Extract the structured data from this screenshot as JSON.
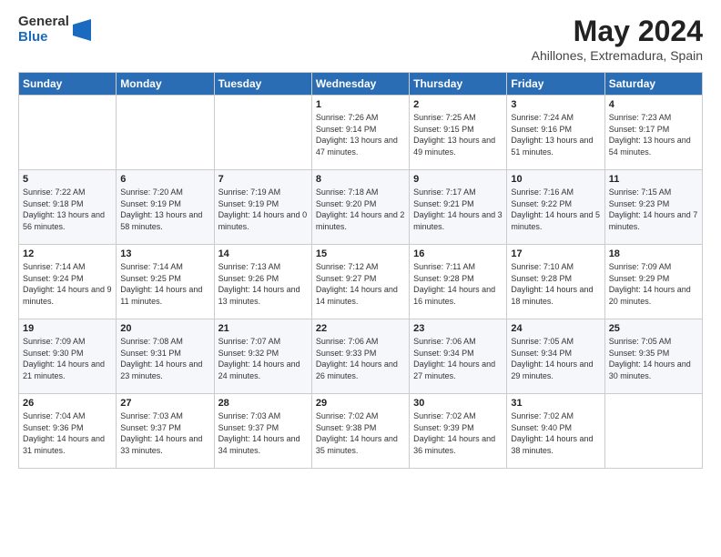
{
  "logo": {
    "general": "General",
    "blue": "Blue"
  },
  "header": {
    "title": "May 2024",
    "subtitle": "Ahillones, Extremadura, Spain"
  },
  "weekdays": [
    "Sunday",
    "Monday",
    "Tuesday",
    "Wednesday",
    "Thursday",
    "Friday",
    "Saturday"
  ],
  "weeks": [
    [
      {
        "day": "",
        "sunrise": "",
        "sunset": "",
        "daylight": ""
      },
      {
        "day": "",
        "sunrise": "",
        "sunset": "",
        "daylight": ""
      },
      {
        "day": "",
        "sunrise": "",
        "sunset": "",
        "daylight": ""
      },
      {
        "day": "1",
        "sunrise": "Sunrise: 7:26 AM",
        "sunset": "Sunset: 9:14 PM",
        "daylight": "Daylight: 13 hours and 47 minutes."
      },
      {
        "day": "2",
        "sunrise": "Sunrise: 7:25 AM",
        "sunset": "Sunset: 9:15 PM",
        "daylight": "Daylight: 13 hours and 49 minutes."
      },
      {
        "day": "3",
        "sunrise": "Sunrise: 7:24 AM",
        "sunset": "Sunset: 9:16 PM",
        "daylight": "Daylight: 13 hours and 51 minutes."
      },
      {
        "day": "4",
        "sunrise": "Sunrise: 7:23 AM",
        "sunset": "Sunset: 9:17 PM",
        "daylight": "Daylight: 13 hours and 54 minutes."
      }
    ],
    [
      {
        "day": "5",
        "sunrise": "Sunrise: 7:22 AM",
        "sunset": "Sunset: 9:18 PM",
        "daylight": "Daylight: 13 hours and 56 minutes."
      },
      {
        "day": "6",
        "sunrise": "Sunrise: 7:20 AM",
        "sunset": "Sunset: 9:19 PM",
        "daylight": "Daylight: 13 hours and 58 minutes."
      },
      {
        "day": "7",
        "sunrise": "Sunrise: 7:19 AM",
        "sunset": "Sunset: 9:19 PM",
        "daylight": "Daylight: 14 hours and 0 minutes."
      },
      {
        "day": "8",
        "sunrise": "Sunrise: 7:18 AM",
        "sunset": "Sunset: 9:20 PM",
        "daylight": "Daylight: 14 hours and 2 minutes."
      },
      {
        "day": "9",
        "sunrise": "Sunrise: 7:17 AM",
        "sunset": "Sunset: 9:21 PM",
        "daylight": "Daylight: 14 hours and 3 minutes."
      },
      {
        "day": "10",
        "sunrise": "Sunrise: 7:16 AM",
        "sunset": "Sunset: 9:22 PM",
        "daylight": "Daylight: 14 hours and 5 minutes."
      },
      {
        "day": "11",
        "sunrise": "Sunrise: 7:15 AM",
        "sunset": "Sunset: 9:23 PM",
        "daylight": "Daylight: 14 hours and 7 minutes."
      }
    ],
    [
      {
        "day": "12",
        "sunrise": "Sunrise: 7:14 AM",
        "sunset": "Sunset: 9:24 PM",
        "daylight": "Daylight: 14 hours and 9 minutes."
      },
      {
        "day": "13",
        "sunrise": "Sunrise: 7:14 AM",
        "sunset": "Sunset: 9:25 PM",
        "daylight": "Daylight: 14 hours and 11 minutes."
      },
      {
        "day": "14",
        "sunrise": "Sunrise: 7:13 AM",
        "sunset": "Sunset: 9:26 PM",
        "daylight": "Daylight: 14 hours and 13 minutes."
      },
      {
        "day": "15",
        "sunrise": "Sunrise: 7:12 AM",
        "sunset": "Sunset: 9:27 PM",
        "daylight": "Daylight: 14 hours and 14 minutes."
      },
      {
        "day": "16",
        "sunrise": "Sunrise: 7:11 AM",
        "sunset": "Sunset: 9:28 PM",
        "daylight": "Daylight: 14 hours and 16 minutes."
      },
      {
        "day": "17",
        "sunrise": "Sunrise: 7:10 AM",
        "sunset": "Sunset: 9:28 PM",
        "daylight": "Daylight: 14 hours and 18 minutes."
      },
      {
        "day": "18",
        "sunrise": "Sunrise: 7:09 AM",
        "sunset": "Sunset: 9:29 PM",
        "daylight": "Daylight: 14 hours and 20 minutes."
      }
    ],
    [
      {
        "day": "19",
        "sunrise": "Sunrise: 7:09 AM",
        "sunset": "Sunset: 9:30 PM",
        "daylight": "Daylight: 14 hours and 21 minutes."
      },
      {
        "day": "20",
        "sunrise": "Sunrise: 7:08 AM",
        "sunset": "Sunset: 9:31 PM",
        "daylight": "Daylight: 14 hours and 23 minutes."
      },
      {
        "day": "21",
        "sunrise": "Sunrise: 7:07 AM",
        "sunset": "Sunset: 9:32 PM",
        "daylight": "Daylight: 14 hours and 24 minutes."
      },
      {
        "day": "22",
        "sunrise": "Sunrise: 7:06 AM",
        "sunset": "Sunset: 9:33 PM",
        "daylight": "Daylight: 14 hours and 26 minutes."
      },
      {
        "day": "23",
        "sunrise": "Sunrise: 7:06 AM",
        "sunset": "Sunset: 9:34 PM",
        "daylight": "Daylight: 14 hours and 27 minutes."
      },
      {
        "day": "24",
        "sunrise": "Sunrise: 7:05 AM",
        "sunset": "Sunset: 9:34 PM",
        "daylight": "Daylight: 14 hours and 29 minutes."
      },
      {
        "day": "25",
        "sunrise": "Sunrise: 7:05 AM",
        "sunset": "Sunset: 9:35 PM",
        "daylight": "Daylight: 14 hours and 30 minutes."
      }
    ],
    [
      {
        "day": "26",
        "sunrise": "Sunrise: 7:04 AM",
        "sunset": "Sunset: 9:36 PM",
        "daylight": "Daylight: 14 hours and 31 minutes."
      },
      {
        "day": "27",
        "sunrise": "Sunrise: 7:03 AM",
        "sunset": "Sunset: 9:37 PM",
        "daylight": "Daylight: 14 hours and 33 minutes."
      },
      {
        "day": "28",
        "sunrise": "Sunrise: 7:03 AM",
        "sunset": "Sunset: 9:37 PM",
        "daylight": "Daylight: 14 hours and 34 minutes."
      },
      {
        "day": "29",
        "sunrise": "Sunrise: 7:02 AM",
        "sunset": "Sunset: 9:38 PM",
        "daylight": "Daylight: 14 hours and 35 minutes."
      },
      {
        "day": "30",
        "sunrise": "Sunrise: 7:02 AM",
        "sunset": "Sunset: 9:39 PM",
        "daylight": "Daylight: 14 hours and 36 minutes."
      },
      {
        "day": "31",
        "sunrise": "Sunrise: 7:02 AM",
        "sunset": "Sunset: 9:40 PM",
        "daylight": "Daylight: 14 hours and 38 minutes."
      },
      {
        "day": "",
        "sunrise": "",
        "sunset": "",
        "daylight": ""
      }
    ]
  ]
}
